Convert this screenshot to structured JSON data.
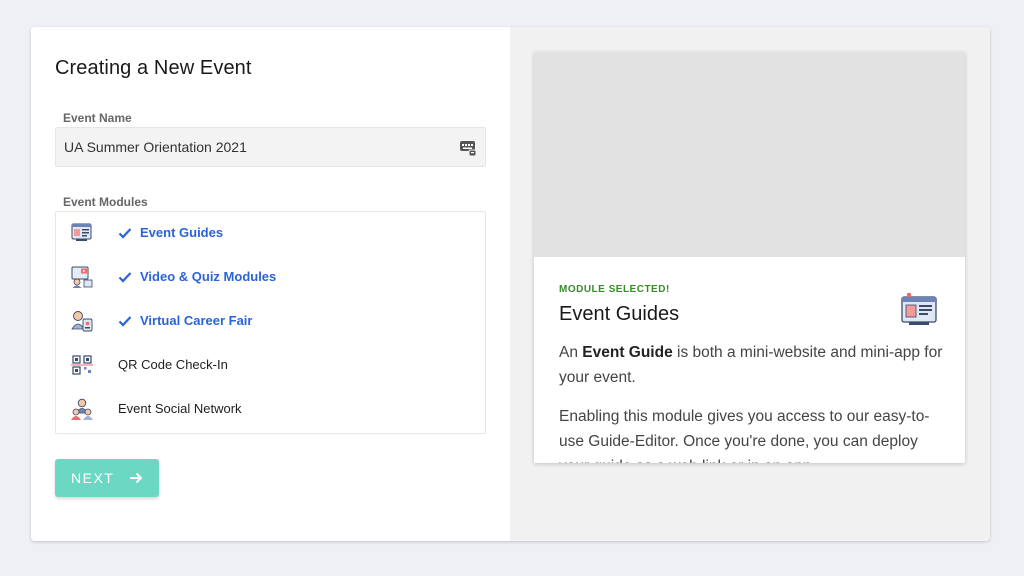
{
  "form": {
    "title": "Creating a New Event",
    "event_name_label": "Event Name",
    "event_name_value": "UA Summer Orientation 2021",
    "modules_label": "Event Modules",
    "next_label": "NEXT"
  },
  "modules": [
    {
      "label": "Event Guides",
      "selected": true,
      "icon": "event-guide-icon"
    },
    {
      "label": "Video & Quiz Modules",
      "selected": true,
      "icon": "video-quiz-icon"
    },
    {
      "label": "Virtual Career Fair",
      "selected": true,
      "icon": "career-fair-icon"
    },
    {
      "label": "QR Code Check-In",
      "selected": false,
      "icon": "qr-code-icon"
    },
    {
      "label": "Event Social Network",
      "selected": false,
      "icon": "social-network-icon"
    }
  ],
  "preview": {
    "badge": "MODULE SELECTED!",
    "title": "Event Guides",
    "desc_prefix": "An ",
    "desc_bold": "Event Guide",
    "desc_suffix": " is both a mini-website and mini-app for your event.",
    "desc2": "Enabling this module gives you access to our easy-to-use Guide-Editor. Once you're done, you can deploy your guide as a web link or in an app."
  },
  "colors": {
    "accent_blue": "#2b63d9",
    "next_button": "#6ad8c3",
    "badge_green": "#3a8a2c"
  }
}
